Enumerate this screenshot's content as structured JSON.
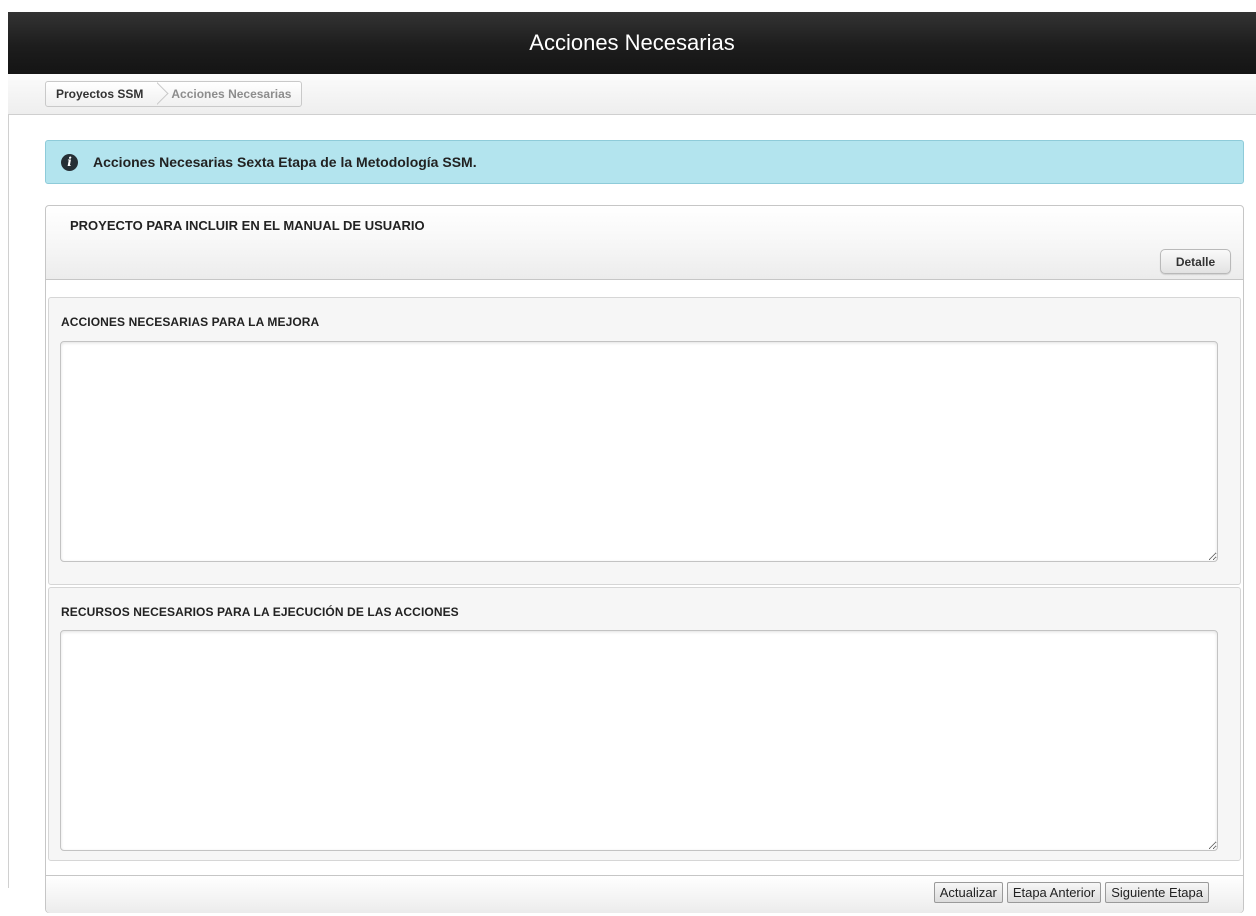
{
  "header": {
    "title": "Acciones Necesarias"
  },
  "breadcrumb": {
    "items": [
      "Proyectos SSM",
      "Acciones Necesarias"
    ]
  },
  "alert": {
    "icon": "info-icon",
    "text": "Acciones Necesarias Sexta Etapa de la Metodología SSM."
  },
  "panel": {
    "project_name": "PROYECTO PARA INCLUIR EN EL MANUAL DE USUARIO",
    "detail_button": "Detalle",
    "sections": [
      {
        "label": "ACCIONES NECESARIAS PARA LA MEJORA",
        "value": ""
      },
      {
        "label": "RECURSOS NECESARIOS PARA LA EJECUCIÓN DE LAS ACCIONES",
        "value": ""
      }
    ],
    "footer_buttons": [
      "Actualizar",
      "Etapa Anterior",
      "Siguiente Etapa"
    ]
  }
}
